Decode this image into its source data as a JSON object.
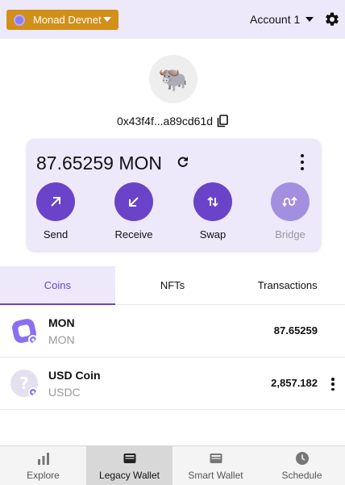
{
  "header": {
    "network_label": "Monad Devnet",
    "account_label": "Account 1",
    "colors": {
      "header_bg": "#ede9fb",
      "network_btn": "#d28f1a"
    }
  },
  "profile": {
    "avatar_emoji": "🐃",
    "address": "0x43f4f...a89cd61d"
  },
  "balance_card": {
    "balance": "87.65259 MON",
    "actions": [
      {
        "label": "Send",
        "icon": "arrow-up-right-icon"
      },
      {
        "label": "Receive",
        "icon": "arrow-down-left-icon"
      },
      {
        "label": "Swap",
        "icon": "swap-icon"
      },
      {
        "label": "Bridge",
        "icon": "bridge-icon",
        "disabled": true
      }
    ]
  },
  "tabs": [
    {
      "label": "Coins",
      "active": true
    },
    {
      "label": "NFTs"
    },
    {
      "label": "Transactions"
    }
  ],
  "coins": [
    {
      "name": "MON",
      "symbol": "MON",
      "amount": "87.65259",
      "icon": "monad-logo-icon"
    },
    {
      "name": "USD Coin",
      "symbol": "USDC",
      "amount": "2,857.182",
      "icon": "unknown-token-icon"
    }
  ],
  "bottom_nav": [
    {
      "label": "Explore",
      "icon": "bar-chart-icon"
    },
    {
      "label": "Legacy Wallet",
      "icon": "wallet-icon",
      "active": true
    },
    {
      "label": "Smart Wallet",
      "icon": "smart-wallet-icon"
    },
    {
      "label": "Schedule",
      "icon": "clock-icon"
    }
  ],
  "accent_color": "#6a43c8"
}
